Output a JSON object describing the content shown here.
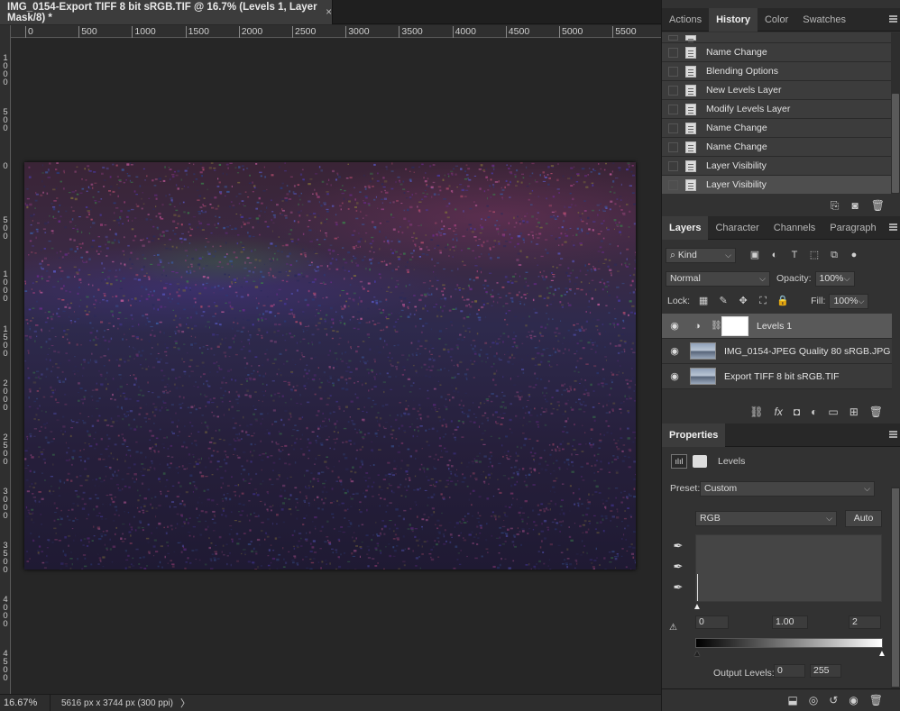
{
  "document": {
    "tab_title": "IMG_0154-Export TIFF 8 bit sRGB.TIF @ 16.7% (Levels 1, Layer Mask/8) *",
    "close_glyph": "×"
  },
  "ruler_top": [
    "0",
    "500",
    "1000",
    "1500",
    "2000",
    "2500",
    "3000",
    "3500",
    "4000",
    "4500",
    "5000",
    "5500"
  ],
  "ruler_left": [
    "1\n0\n0\n0",
    "5\n0\n0",
    "0",
    "5\n0\n0",
    "1\n0\n0\n0",
    "1\n5\n0\n0",
    "2\n0\n0\n0",
    "2\n5\n0\n0",
    "3\n0\n0\n0",
    "3\n5\n0\n0",
    "4\n0\n0\n0",
    "4\n5\n0\n0"
  ],
  "status": {
    "zoom": "16.67%",
    "doc_info": "5616 px x 3744 px (300 ppi)",
    "arrow": "〉"
  },
  "history": {
    "tabs": [
      "Actions",
      "History",
      "Color",
      "Swatches"
    ],
    "active_tab": "History",
    "items": [
      "Name Change",
      "Blending Options",
      "New Levels Layer",
      "Modify Levels Layer",
      "Name Change",
      "Name Change",
      "Layer Visibility",
      "Layer Visibility"
    ],
    "selected_index": 7
  },
  "layers": {
    "tabs": [
      "Layers",
      "Character",
      "Channels",
      "Paragraph"
    ],
    "active_tab": "Layers",
    "filter_kind": "Kind",
    "blend_mode": "Normal",
    "opacity_label": "Opacity:",
    "opacity_value": "100%",
    "lock_label": "Lock:",
    "fill_label": "Fill:",
    "fill_value": "100%",
    "items": [
      {
        "name": "Levels 1",
        "selected": true
      },
      {
        "name": "IMG_0154-JPEG Quality 80 sRGB.JPG",
        "selected": false
      },
      {
        "name": "Export TIFF 8 bit sRGB.TIF",
        "selected": false
      }
    ]
  },
  "properties": {
    "tab": "Properties",
    "adjustment": "Levels",
    "preset_label": "Preset:",
    "preset_value": "Custom",
    "channel": "RGB",
    "auto_label": "Auto",
    "input_black": "0",
    "input_gamma": "1.00",
    "input_white": "2",
    "output_label": "Output Levels:",
    "output_black": "0",
    "output_white": "255"
  },
  "colors": {
    "panel_bg": "#323232",
    "canvas_bg": "#262626",
    "selection": "#595959"
  }
}
